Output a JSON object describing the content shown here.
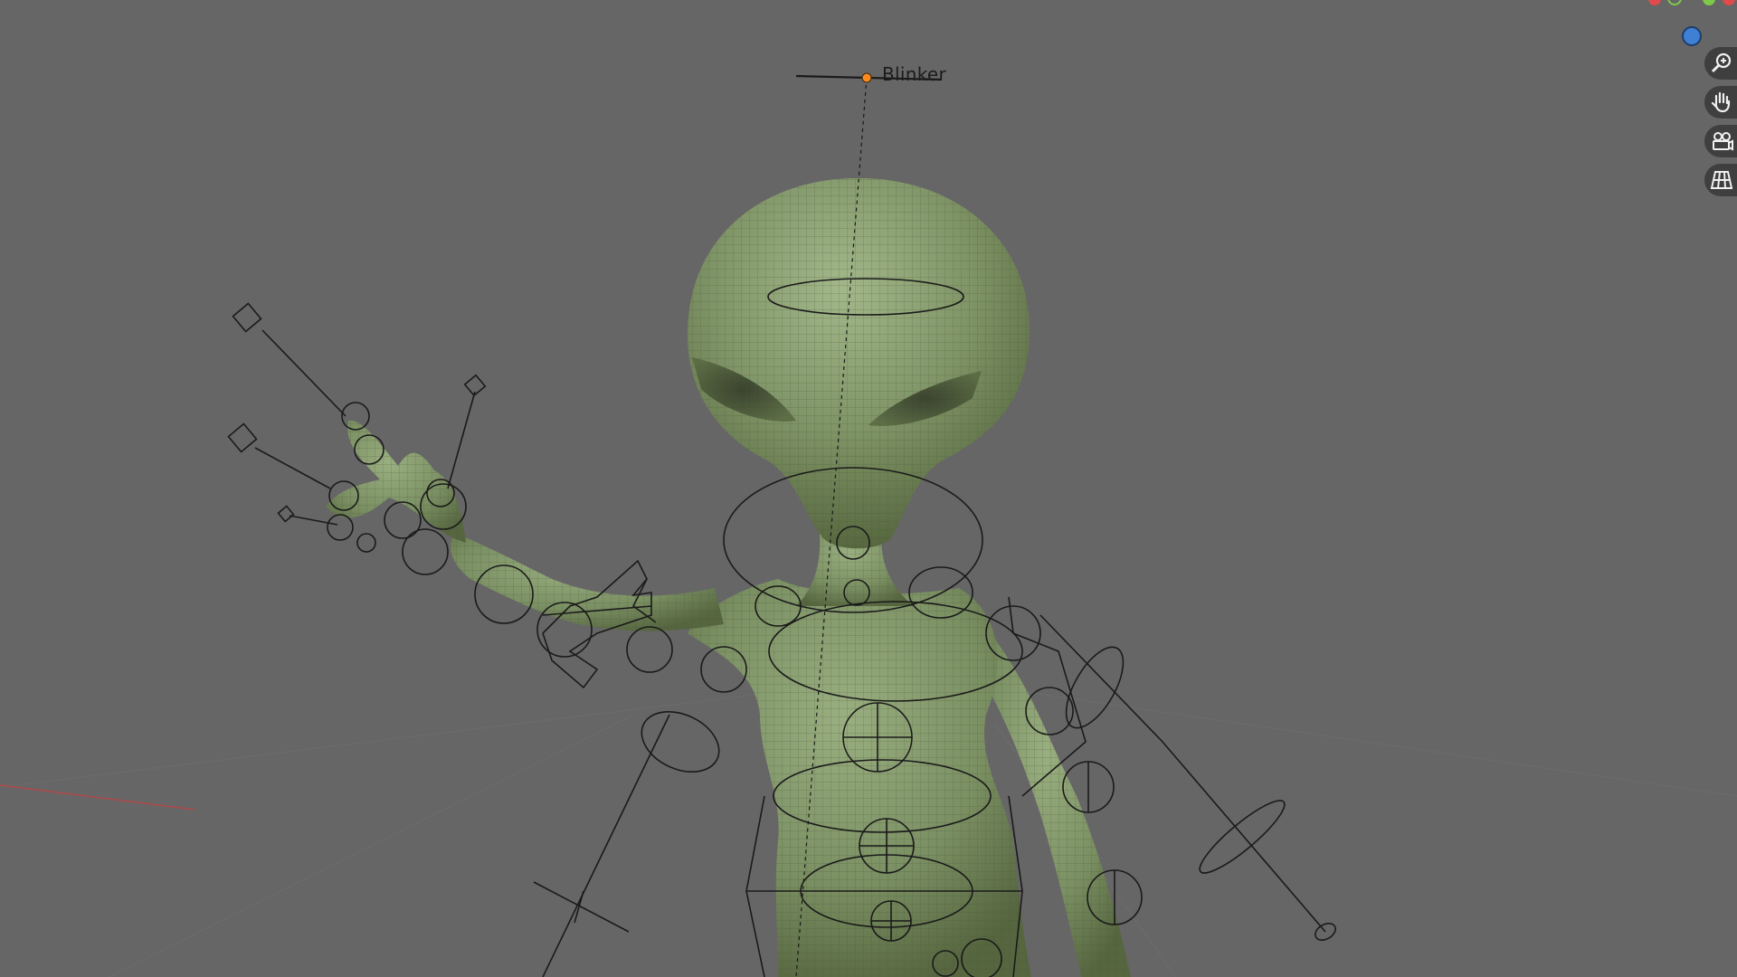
{
  "viewport": {
    "bone_label": "Blinker"
  },
  "nav_gizmo": {
    "colors": {
      "x_axis": "#e04a4a",
      "y_axis": "#7ec94a",
      "z_axis": "#3f7fd4"
    }
  },
  "nav_tools": [
    {
      "icon": "zoom-icon"
    },
    {
      "icon": "pan-hand-icon"
    },
    {
      "icon": "camera-icon"
    },
    {
      "icon": "perspective-grid-icon"
    }
  ],
  "colors": {
    "background": "#666666",
    "mesh_green": "#7f9466",
    "wire": "#1a1a1a",
    "bone_selected": "#ff8a1e"
  }
}
